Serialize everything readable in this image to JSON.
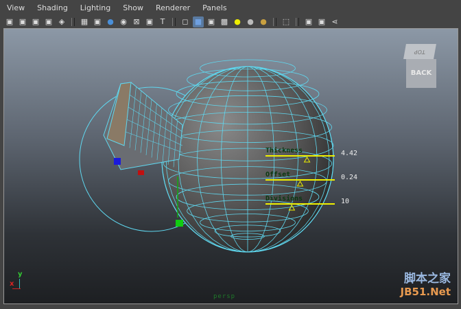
{
  "menu": [
    "View",
    "Shading",
    "Lighting",
    "Show",
    "Renderer",
    "Panels"
  ],
  "toolbar_icons": [
    "camera-select-icon",
    "camera-attributes-icon",
    "bookmark-icon",
    "image-plane-icon",
    "grid-icon",
    "wireframe-icon",
    "film-gate-icon",
    "smooth-shade-icon",
    "xray-icon",
    "isolate-icon",
    "components-icon",
    "texture-icon",
    "wireframe-cube-icon",
    "shaded-cube-icon",
    "wireframe-on-shaded-icon",
    "checker-icon",
    "default-light-icon",
    "all-lights-icon",
    "shadows-icon",
    "select-tool-icon",
    "cube-view-icon",
    "two-panes-icon",
    "share-icon"
  ],
  "viewcube": {
    "face": "BACK",
    "top": "TOP"
  },
  "manipulator": {
    "items": [
      {
        "label": "Thickness",
        "value": "4.42",
        "fraction": 0.6
      },
      {
        "label": "Offset",
        "value": "0.24",
        "fraction": 0.5
      },
      {
        "label": "Divisions",
        "value": "10",
        "fraction": 0.38
      }
    ]
  },
  "camera_label": "persp",
  "axis": {
    "x": "x",
    "y": "y"
  },
  "watermark": {
    "line1": "脚本之家",
    "line2": "JB51.Net"
  },
  "colors": {
    "wire": "#5fd8f0",
    "manip": "#f0f000",
    "label": "#0b3a12"
  }
}
